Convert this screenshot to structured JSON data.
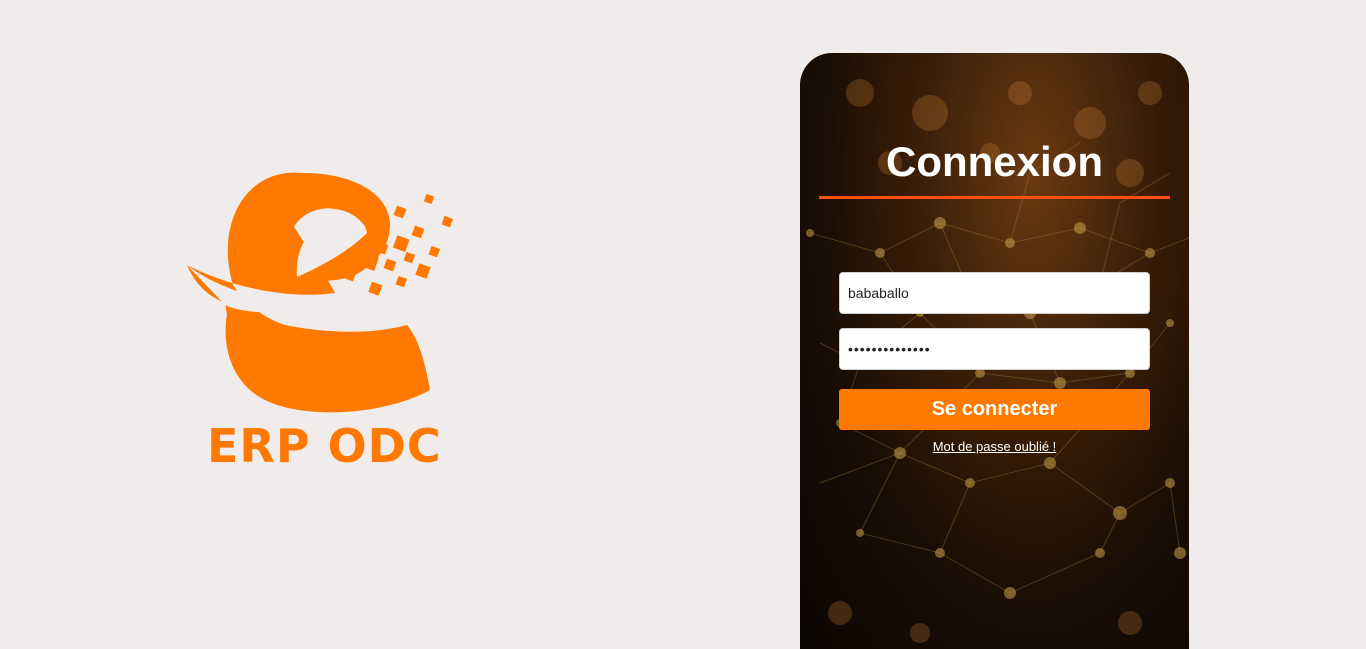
{
  "brand": {
    "name": "ERP ODC",
    "logo_icon": "e-letter-pixel-logo-icon",
    "color": "#ff7900"
  },
  "login": {
    "title": "Connexion",
    "username_value": "bababallo",
    "password_value": "••••••••••••••",
    "submit_label": "Se connecter",
    "forgot_password": "Mot de passe oublié !",
    "accent_color": "#ff7900",
    "underline_color": "#ff4f0e"
  }
}
